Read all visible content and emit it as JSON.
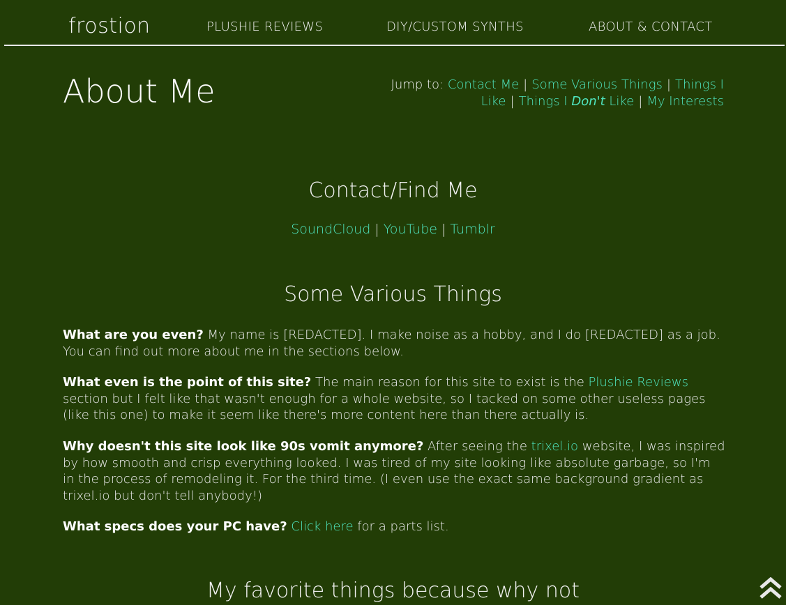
{
  "brand": "frostion",
  "nav": {
    "items": [
      "PLUSHIE REVIEWS",
      "DIY/CUSTOM SYNTHS",
      "ABOUT & CONTACT"
    ]
  },
  "page_title": "About Me",
  "jump": {
    "label": "Jump to:",
    "links": [
      "Contact Me",
      "Some Various Things",
      "Things I Like",
      "Things I",
      "Don't",
      "Like",
      "My Interests"
    ]
  },
  "contact": {
    "title": "Contact/Find Me",
    "links": [
      "SoundCloud",
      "YouTube",
      "Tumblr"
    ]
  },
  "various": {
    "title": "Some Various Things",
    "q1": "What are you even?",
    "a1": " My name is [REDACTED]. I make noise as a hobby, and I do [REDACTED] as a job. You can find out more about me in the sections below.",
    "q2": "What even is the point of this site?",
    "a2_pre": " The main reason for this site to exist is the ",
    "a2_link": "Plushie Reviews",
    "a2_post": " section but I felt like that wasn't enough for a whole website, so I tacked on some other useless pages (like this one) to make it seem like there's more content here than there actually is.",
    "q3": "Why doesn't this site look like 90s vomit anymore?",
    "a3_pre": " After seeing the ",
    "a3_link": "trixel.io",
    "a3_post": " website, I was inspired by how smooth and crisp everything looked. I was tired of my site looking like absolute garbage, so I'm in the process of remodeling it. For the third time. (I even use the exact same background gradient as trixel.io but don't tell anybody!)",
    "q4": "What specs does your PC have?",
    "a4_link": "Click here",
    "a4_post": " for a parts list."
  },
  "favorites": {
    "title": "My favorite things because why not"
  },
  "colors": {
    "background": "#223d06",
    "link": "#4fe6c0",
    "text": "#eeeeee"
  }
}
